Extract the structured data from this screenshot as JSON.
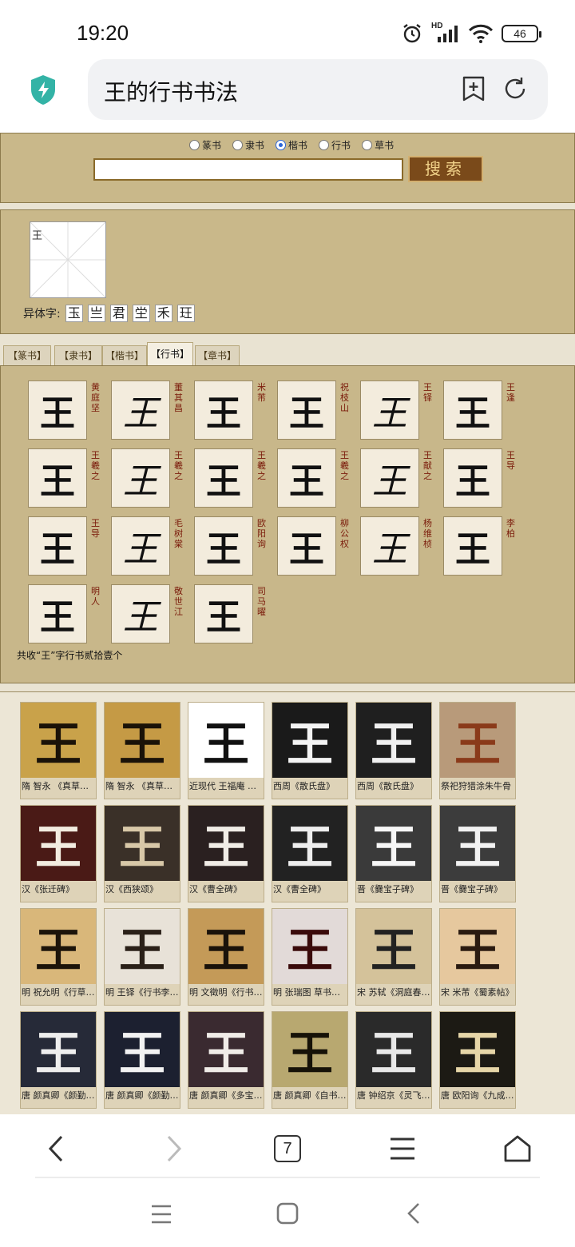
{
  "status_bar": {
    "time": "19:20",
    "hd": "HD",
    "battery": "46"
  },
  "address_bar": {
    "query": "王的行书书法"
  },
  "search": {
    "radios": [
      {
        "label": "篆书",
        "selected": false
      },
      {
        "label": "隶书",
        "selected": false
      },
      {
        "label": "楷书",
        "selected": true
      },
      {
        "label": "行书",
        "selected": false
      },
      {
        "label": "草书",
        "selected": false
      }
    ],
    "input_value": "",
    "button_label": "搜索"
  },
  "character": {
    "alt_text": "王",
    "variants_label": "异体字:",
    "variants": [
      "玉",
      "亗",
      "君",
      "坣",
      "禾",
      "玨"
    ]
  },
  "tabs": [
    {
      "label": "【篆书】",
      "active": false
    },
    {
      "label": "【隶书】",
      "active": false
    },
    {
      "label": "【楷书】",
      "active": false
    },
    {
      "label": "【行书】",
      "active": true
    },
    {
      "label": "【章书】",
      "active": false
    }
  ],
  "xingshu": {
    "glyph": "王",
    "items": [
      {
        "author": "黄庭坚"
      },
      {
        "author": "董其昌"
      },
      {
        "author": "米芾"
      },
      {
        "author": "祝枝山"
      },
      {
        "author": "王铎"
      },
      {
        "author": "王逢"
      },
      {
        "author": "王羲之"
      },
      {
        "author": "王羲之"
      },
      {
        "author": "王羲之"
      },
      {
        "author": "王羲之"
      },
      {
        "author": "王献之"
      },
      {
        "author": "王导"
      },
      {
        "author": "王导"
      },
      {
        "author": "毛树棠"
      },
      {
        "author": "欧阳询"
      },
      {
        "author": "柳公权"
      },
      {
        "author": "杨维桢"
      },
      {
        "author": "李柏"
      },
      {
        "author": "明人"
      },
      {
        "author": "敬世江"
      },
      {
        "author": "司马曜"
      }
    ],
    "total": "共收“王”字行书贰拾壹个"
  },
  "gallery": {
    "items": [
      {
        "caption": "隋 智永 《真草千字文》",
        "bg": "#c9a24a",
        "fg": "#1a1208"
      },
      {
        "caption": "隋 智永 《真草千字文》",
        "bg": "#c59a45",
        "fg": "#1a1208"
      },
      {
        "caption": "近现代 王福庵 《说文部首》",
        "bg": "#ffffff",
        "fg": "#111111"
      },
      {
        "caption": "西周《散氏盘》",
        "bg": "#1a1a1a",
        "fg": "#f4f4f4"
      },
      {
        "caption": "西周《散氏盘》",
        "bg": "#1f1f1f",
        "fg": "#f0f0f0"
      },
      {
        "caption": "祭祀狩猎涂朱牛骨",
        "bg": "#b89a7a",
        "fg": "#8a3a1a"
      },
      {
        "caption": "汉《张迁碑》",
        "bg": "#4a1a16",
        "fg": "#f2ece0"
      },
      {
        "caption": "汉《西狭颂》",
        "bg": "#3a3028",
        "fg": "#d8c8a8"
      },
      {
        "caption": "汉《曹全碑》",
        "bg": "#2a2020",
        "fg": "#f0ece6"
      },
      {
        "caption": "汉《曹全碑》",
        "bg": "#222222",
        "fg": "#eeeeee"
      },
      {
        "caption": "晋《爨宝子碑》",
        "bg": "#3a3a3a",
        "fg": "#f6f6f6"
      },
      {
        "caption": "晋《爨宝子碑》",
        "bg": "#3c3c3c",
        "fg": "#f2f2f2"
      },
      {
        "caption": "明 祝允明《行草诗卷》",
        "bg": "#d9b77a",
        "fg": "#1c140a"
      },
      {
        "caption": "明 王铎《行书李贺诗》",
        "bg": "#e8e2d8",
        "fg": "#2a2018"
      },
      {
        "caption": "明 文徵明《行书诗卷》",
        "bg": "#c49a58",
        "fg": "#1a120a"
      },
      {
        "caption": "明 张瑞图 草书五言诗",
        "bg": "#e2dad8",
        "fg": "#3a0a0a"
      },
      {
        "caption": "宋 苏轼《洞庭春色赋》",
        "bg": "#d4c29a",
        "fg": "#222222"
      },
      {
        "caption": "宋 米芾《蜀素帖》",
        "bg": "#e6c89e",
        "fg": "#2a1a10"
      },
      {
        "caption": "唐 颜真卿《颜勤礼碑》",
        "bg": "#262a38",
        "fg": "#eeeeee"
      },
      {
        "caption": "唐 颜真卿《颜勤礼碑》",
        "bg": "#1c2030",
        "fg": "#f2f2f2"
      },
      {
        "caption": "唐 颜真卿《多宝塔碑》",
        "bg": "#3a2a30",
        "fg": "#f0ece8"
      },
      {
        "caption": "唐 颜真卿《自书告身帖》",
        "bg": "#b8a870",
        "fg": "#161208"
      },
      {
        "caption": "唐 钟绍京《灵飞经》",
        "bg": "#2a2a2a",
        "fg": "#e8e8e8"
      },
      {
        "caption": "唐 欧阳询《九成宫》",
        "bg": "#1c1a14",
        "fg": "#e6d6a8"
      }
    ]
  },
  "browser_nav": {
    "tab_count": "7"
  }
}
